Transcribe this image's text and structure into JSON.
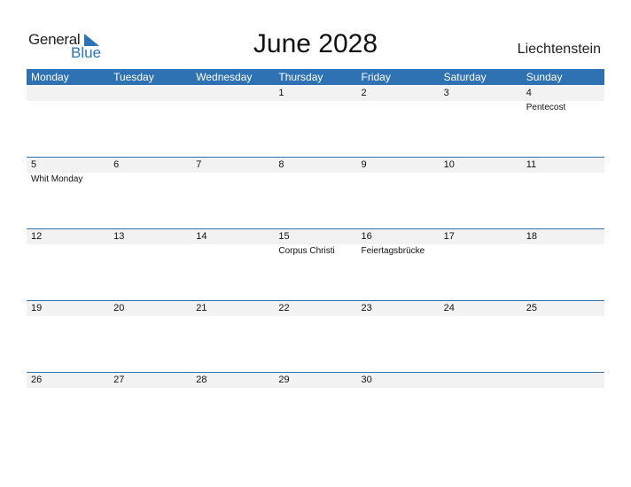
{
  "logo": {
    "line1": "General",
    "line2": "Blue",
    "brand_color": "#2a74b8"
  },
  "title": "June 2028",
  "country": "Liechtenstein",
  "header_color": "#2e72b4",
  "weekdays": [
    "Monday",
    "Tuesday",
    "Wednesday",
    "Thursday",
    "Friday",
    "Saturday",
    "Sunday"
  ],
  "weeks": [
    {
      "days": [
        {
          "d": "",
          "h": ""
        },
        {
          "d": "",
          "h": ""
        },
        {
          "d": "",
          "h": ""
        },
        {
          "d": "1",
          "h": ""
        },
        {
          "d": "2",
          "h": ""
        },
        {
          "d": "3",
          "h": ""
        },
        {
          "d": "4",
          "h": "Pentecost"
        }
      ]
    },
    {
      "days": [
        {
          "d": "5",
          "h": "Whit Monday"
        },
        {
          "d": "6",
          "h": ""
        },
        {
          "d": "7",
          "h": ""
        },
        {
          "d": "8",
          "h": ""
        },
        {
          "d": "9",
          "h": ""
        },
        {
          "d": "10",
          "h": ""
        },
        {
          "d": "11",
          "h": ""
        }
      ]
    },
    {
      "days": [
        {
          "d": "12",
          "h": ""
        },
        {
          "d": "13",
          "h": ""
        },
        {
          "d": "14",
          "h": ""
        },
        {
          "d": "15",
          "h": "Corpus Christi"
        },
        {
          "d": "16",
          "h": "Feiertagsbrücke"
        },
        {
          "d": "17",
          "h": ""
        },
        {
          "d": "18",
          "h": ""
        }
      ]
    },
    {
      "days": [
        {
          "d": "19",
          "h": ""
        },
        {
          "d": "20",
          "h": ""
        },
        {
          "d": "21",
          "h": ""
        },
        {
          "d": "22",
          "h": ""
        },
        {
          "d": "23",
          "h": ""
        },
        {
          "d": "24",
          "h": ""
        },
        {
          "d": "25",
          "h": ""
        }
      ]
    },
    {
      "days": [
        {
          "d": "26",
          "h": ""
        },
        {
          "d": "27",
          "h": ""
        },
        {
          "d": "28",
          "h": ""
        },
        {
          "d": "29",
          "h": ""
        },
        {
          "d": "30",
          "h": ""
        },
        {
          "d": "",
          "h": ""
        },
        {
          "d": "",
          "h": ""
        }
      ]
    }
  ]
}
